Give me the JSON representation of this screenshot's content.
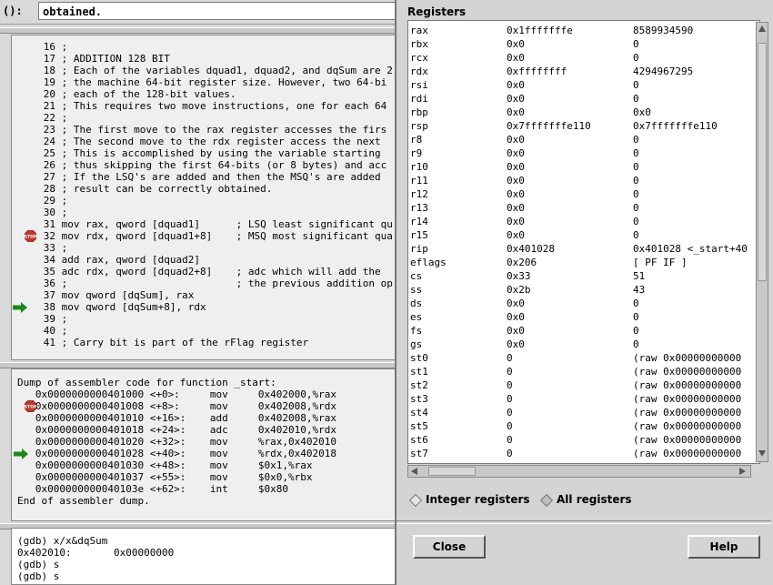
{
  "arg_bar": {
    "label": "():",
    "value": "obtained."
  },
  "source_lines": [
    {
      "n": "16",
      "t": " ;"
    },
    {
      "n": "17",
      "t": " ; ADDITION 128 BIT"
    },
    {
      "n": "18",
      "t": " ; Each of the variables dquad1, dquad2, and dqSum are 2"
    },
    {
      "n": "19",
      "t": " ; the machine 64-bit register size. However, two 64-bi"
    },
    {
      "n": "20",
      "t": " ; each of the 128-bit values."
    },
    {
      "n": "21",
      "t": " ; This requires two move instructions, one for each 64"
    },
    {
      "n": "22",
      "t": " ;"
    },
    {
      "n": "23",
      "t": " ; The first move to the rax register accesses the firs"
    },
    {
      "n": "24",
      "t": " ; The second move to the rdx register access the next"
    },
    {
      "n": "25",
      "t": " ; This is accomplished by using the variable starting"
    },
    {
      "n": "26",
      "t": " ; thus skipping the first 64-bits (or 8 bytes) and acc"
    },
    {
      "n": "27",
      "t": " ; If the LSQ's are added and then the MSQ's are added"
    },
    {
      "n": "28",
      "t": " ; result can be correctly obtained."
    },
    {
      "n": "29",
      "t": " ;"
    },
    {
      "n": "30",
      "t": " ;"
    },
    {
      "n": "31",
      "t": " mov rax, qword [dquad1]      ; LSQ least significant qu"
    },
    {
      "n": "32",
      "t": " mov rdx, qword [dquad1+8]    ; MSQ most significant qua"
    },
    {
      "n": "33",
      "t": " ;"
    },
    {
      "n": "34",
      "t": " add rax, qword [dquad2]"
    },
    {
      "n": "35",
      "t": " adc rdx, qword [dquad2+8]    ; adc which will add the"
    },
    {
      "n": "36",
      "t": " ;                            ; the previous addition op"
    },
    {
      "n": "37",
      "t": " mov qword [dqSum], rax"
    },
    {
      "n": "38",
      "t": " mov qword [dqSum+8], rdx"
    },
    {
      "n": "39",
      "t": " ;"
    },
    {
      "n": "40",
      "t": " ;"
    },
    {
      "n": "41",
      "t": " ; Carry bit is part of the rFlag register"
    }
  ],
  "asm": {
    "header": "Dump of assembler code for function _start:",
    "lines": [
      "   0x0000000000401000 <+0>:     mov     0x402000,%rax",
      "   0x0000000000401008 <+8>:     mov     0x402008,%rdx",
      "   0x0000000000401010 <+16>:    add     0x402008,%rax",
      "   0x0000000000401018 <+24>:    adc     0x402010,%rdx",
      "   0x0000000000401020 <+32>:    mov     %rax,0x402010",
      "   0x0000000000401028 <+40>:    mov     %rdx,0x402018",
      "   0x0000000000401030 <+48>:    mov     $0x1,%rax",
      "   0x0000000000401037 <+55>:    mov     $0x0,%rbx",
      "   0x000000000040103e <+62>:    int     $0x80"
    ],
    "footer": "End of assembler dump."
  },
  "gdb_console": [
    "(gdb) x/x&dqSum",
    "0x402010:       0x00000000",
    "(gdb) s",
    "(gdb) s"
  ],
  "registers_dialog": {
    "title": "Registers",
    "rows": [
      {
        "name": "rax",
        "value": "0x1fffffffe",
        "raw": "8589934590"
      },
      {
        "name": "rbx",
        "value": "0x0",
        "raw": "0"
      },
      {
        "name": "rcx",
        "value": "0x0",
        "raw": "0"
      },
      {
        "name": "rdx",
        "value": "0xffffffff",
        "raw": "4294967295"
      },
      {
        "name": "rsi",
        "value": "0x0",
        "raw": "0"
      },
      {
        "name": "rdi",
        "value": "0x0",
        "raw": "0"
      },
      {
        "name": "rbp",
        "value": "0x0",
        "raw": "0x0"
      },
      {
        "name": "rsp",
        "value": "0x7fffffffe110",
        "raw": "0x7fffffffe110"
      },
      {
        "name": "r8",
        "value": "0x0",
        "raw": "0"
      },
      {
        "name": "r9",
        "value": "0x0",
        "raw": "0"
      },
      {
        "name": "r10",
        "value": "0x0",
        "raw": "0"
      },
      {
        "name": "r11",
        "value": "0x0",
        "raw": "0"
      },
      {
        "name": "r12",
        "value": "0x0",
        "raw": "0"
      },
      {
        "name": "r13",
        "value": "0x0",
        "raw": "0"
      },
      {
        "name": "r14",
        "value": "0x0",
        "raw": "0"
      },
      {
        "name": "r15",
        "value": "0x0",
        "raw": "0"
      },
      {
        "name": "rip",
        "value": "0x401028",
        "raw": "0x401028 <_start+40"
      },
      {
        "name": "eflags",
        "value": "0x206",
        "raw": "[ PF IF ]"
      },
      {
        "name": "cs",
        "value": "0x33",
        "raw": "51"
      },
      {
        "name": "ss",
        "value": "0x2b",
        "raw": "43"
      },
      {
        "name": "ds",
        "value": "0x0",
        "raw": "0"
      },
      {
        "name": "es",
        "value": "0x0",
        "raw": "0"
      },
      {
        "name": "fs",
        "value": "0x0",
        "raw": "0"
      },
      {
        "name": "gs",
        "value": "0x0",
        "raw": "0"
      },
      {
        "name": "st0",
        "value": "0",
        "raw": "(raw 0x00000000000"
      },
      {
        "name": "st1",
        "value": "0",
        "raw": "(raw 0x00000000000"
      },
      {
        "name": "st2",
        "value": "0",
        "raw": "(raw 0x00000000000"
      },
      {
        "name": "st3",
        "value": "0",
        "raw": "(raw 0x00000000000"
      },
      {
        "name": "st4",
        "value": "0",
        "raw": "(raw 0x00000000000"
      },
      {
        "name": "st5",
        "value": "0",
        "raw": "(raw 0x00000000000"
      },
      {
        "name": "st6",
        "value": "0",
        "raw": "(raw 0x00000000000"
      },
      {
        "name": "st7",
        "value": "0",
        "raw": "(raw 0x00000000000"
      }
    ],
    "radio_integer": "Integer registers",
    "radio_all": "All registers",
    "close_label": "Close",
    "help_label": "Help"
  },
  "icons": {
    "breakpoint": "stop-sign-icon",
    "execution": "green-arrow-icon"
  },
  "colors": {
    "breakpoint": "#c0392b",
    "execution_arrow": "#1a8a1a"
  }
}
